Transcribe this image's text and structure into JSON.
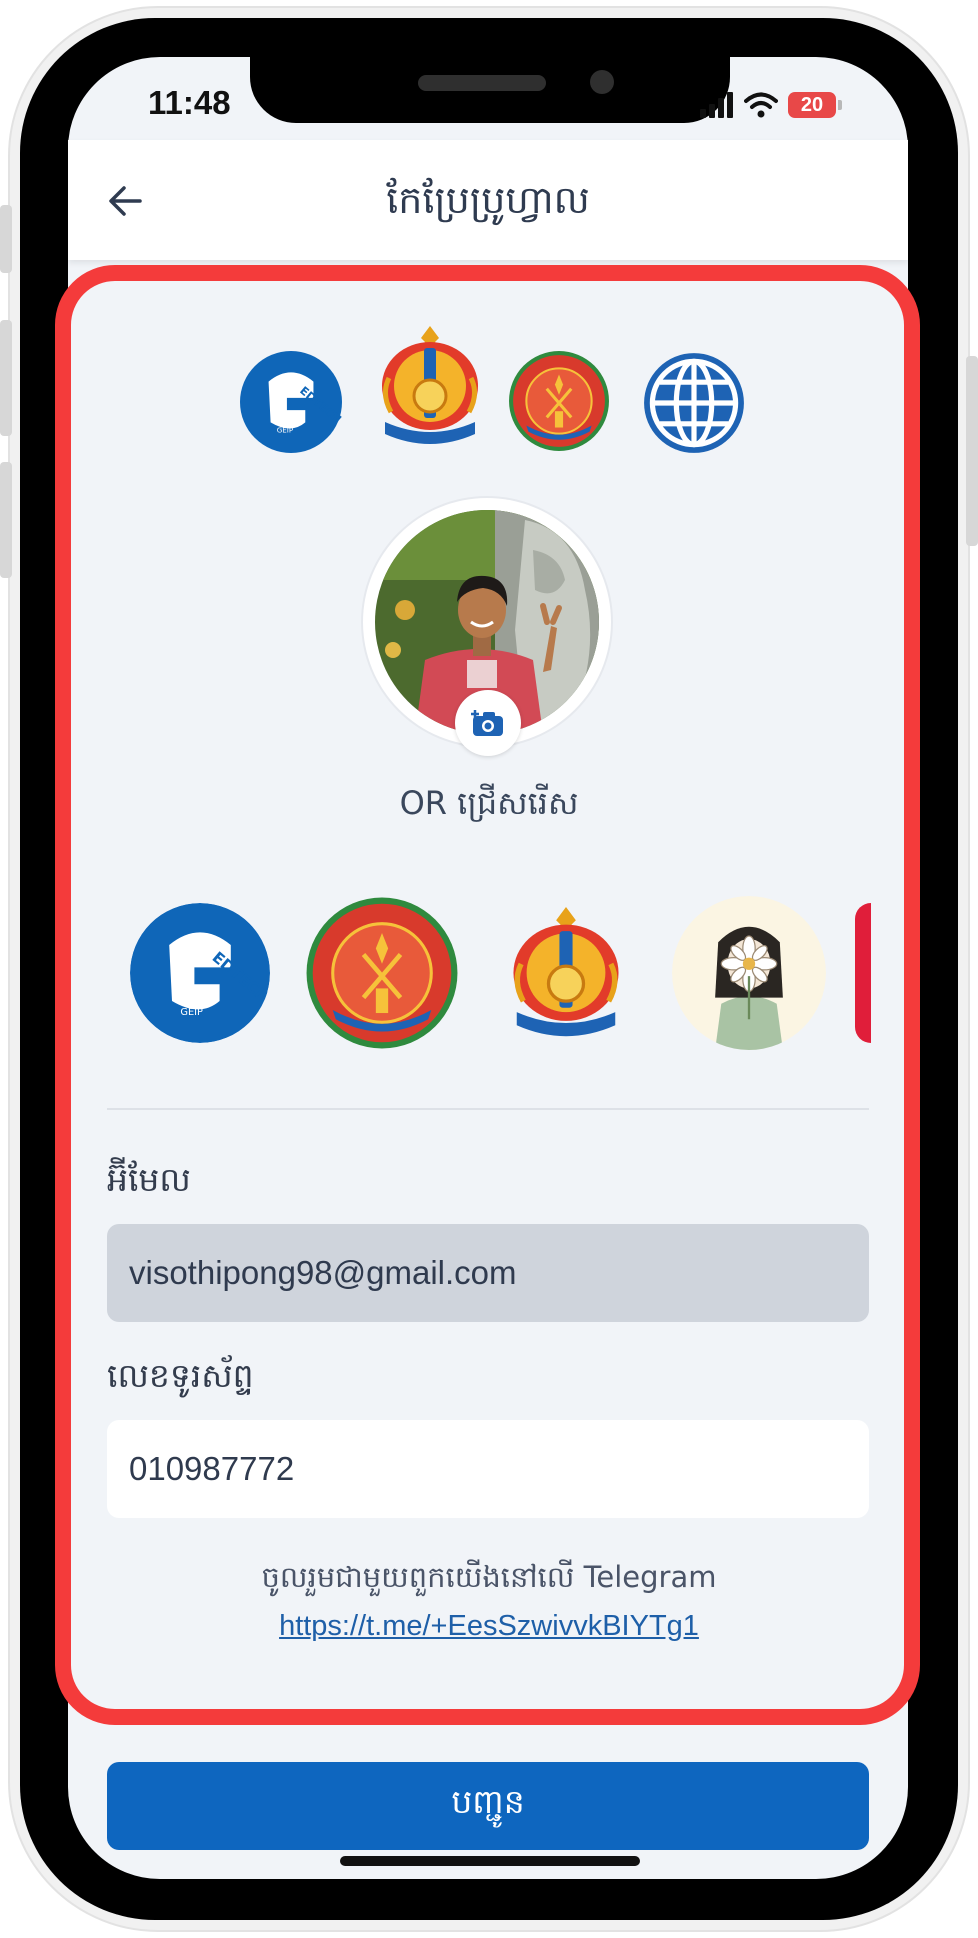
{
  "status_bar": {
    "time": "11:48",
    "battery": "20"
  },
  "header": {
    "title": "កែប្រែប្រូហ្វាល",
    "back_icon": "arrow-left-icon"
  },
  "top_logos": [
    {
      "name": "edtech-geip-logo",
      "text": "EDTECH",
      "sub": "GEIP"
    },
    {
      "name": "ministry-emblem"
    },
    {
      "name": "technical-education-emblem"
    },
    {
      "name": "globe-icon"
    }
  ],
  "avatar": {
    "camera_icon": "camera-add-icon"
  },
  "or_label": "OR ជ្រើសរើស",
  "avatar_choices": [
    {
      "name": "edtech-geip-logo",
      "text": "EDTECH",
      "sub": "GEIP"
    },
    {
      "name": "technical-education-emblem"
    },
    {
      "name": "ministry-emblem"
    },
    {
      "name": "cartoon-girl-flower"
    },
    {
      "name": "red-partial-avatar"
    }
  ],
  "email": {
    "label": "អ៊ីមែល",
    "value": "visothipong98@gmail.com"
  },
  "phone": {
    "label": "លេខទូរស័ព្ទ",
    "value": "010987772"
  },
  "telegram": {
    "text": "ចូលរួមជាមួយពួកយើងនៅលើ Telegram",
    "link": "https://t.me/+EesSzwivvkBIYTg1"
  },
  "submit_label": "បញ្ជូន",
  "colors": {
    "accent": "#0e66bf",
    "highlight": "#f43b3b",
    "screen_bg": "#f1f4f8"
  }
}
